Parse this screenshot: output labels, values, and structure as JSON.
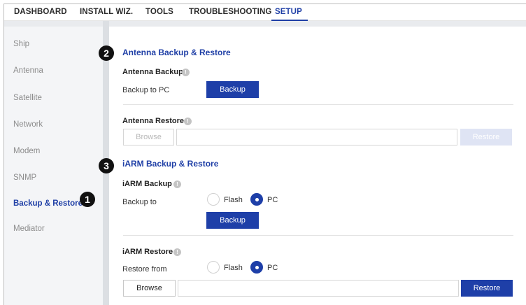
{
  "nav": {
    "tabs": [
      "DASHBOARD",
      "INSTALL WIZ.",
      "TOOLS",
      "TROUBLESHOOTING",
      "SETUP"
    ],
    "active": "SETUP"
  },
  "sidebar": {
    "items": [
      "Ship",
      "Antenna",
      "Satellite",
      "Network",
      "Modem",
      "SNMP",
      "Backup & Restore",
      "Mediator"
    ],
    "active": "Backup & Restore"
  },
  "badges": [
    "1",
    "2",
    "3"
  ],
  "antenna": {
    "title": "Antenna Backup & Restore",
    "backup": {
      "title": "Antenna Backup",
      "label": "Backup to PC",
      "button": "Backup"
    },
    "restore": {
      "title": "Antenna Restore",
      "browse": "Browse",
      "file_value": "",
      "button": "Restore"
    }
  },
  "iarm": {
    "title": "iARM Backup & Restore",
    "backup": {
      "title": "iARM Backup",
      "label": "Backup to",
      "options": [
        "Flash",
        "PC"
      ],
      "selected": "PC",
      "button": "Backup"
    },
    "restore": {
      "title": "iARM Restore",
      "label": "Restore from",
      "options": [
        "Flash",
        "PC"
      ],
      "selected": "PC",
      "browse": "Browse",
      "file_value": "",
      "button": "Restore"
    }
  },
  "colors": {
    "accent": "#1e3fa8",
    "accent_disabled": "#dfe4f4",
    "sidebar_bg": "#f4f5f7",
    "divider": "#dcdfe3"
  },
  "icons": {
    "info": "info-icon"
  }
}
